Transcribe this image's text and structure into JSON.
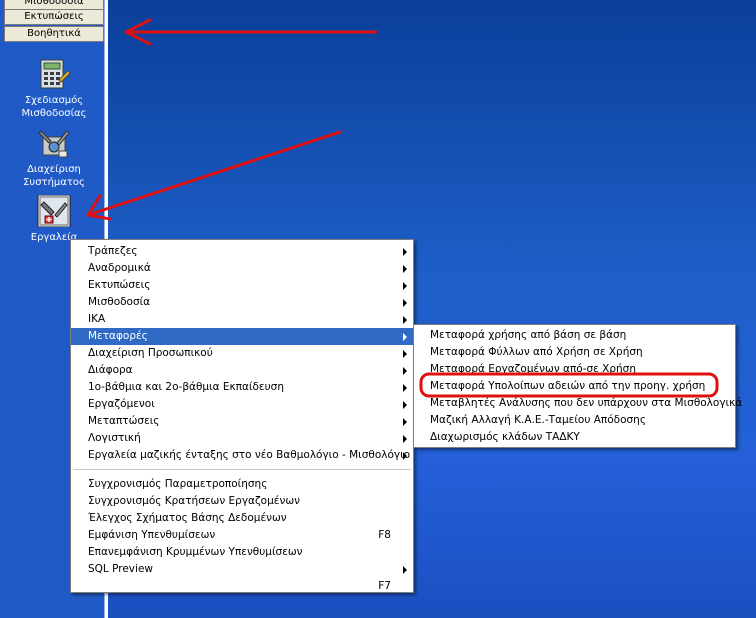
{
  "sidebar": {
    "buttons": [
      "Μισθοδοσία",
      "Εκτυπώσεις",
      "Βοηθητικά"
    ],
    "tools": [
      {
        "line1": "Σχεδιασμός",
        "line2": "Μισθοδοσίας",
        "icon": "calculator-icon"
      },
      {
        "line1": "Διαχείριση",
        "line2": "Συστήματος",
        "icon": "admin-tools-icon"
      },
      {
        "line1": "Εργαλεία",
        "line2": "",
        "icon": "tools-icon"
      }
    ]
  },
  "menu": {
    "items": [
      {
        "label": "Τράπεζες",
        "arrow": true
      },
      {
        "label": "Αναδρομικά",
        "arrow": true
      },
      {
        "label": "Εκτυπώσεις",
        "arrow": true
      },
      {
        "label": "Μισθοδοσία",
        "arrow": true
      },
      {
        "label": "ΙΚΑ",
        "arrow": true
      },
      {
        "label": "Μεταφορές",
        "arrow": true,
        "selected": true
      },
      {
        "label": "Διαχείριση Προσωπικού",
        "arrow": true
      },
      {
        "label": "Διάφορα",
        "arrow": true
      },
      {
        "label": "1ο-βάθμια και 2ο-βάθμια Εκπαίδευση",
        "arrow": true
      },
      {
        "label": "Εργαζόμενοι",
        "arrow": true
      },
      {
        "label": "Μεταπτώσεις",
        "arrow": true
      },
      {
        "label": "Λογιστική",
        "arrow": true
      },
      {
        "label": "Εργαλεία μαζικής ένταξης στο νέο Βαθμολόγιο - Μισθολόγιο",
        "arrow": true
      }
    ],
    "items2": [
      {
        "label": "Συγχρονισμός Παραμετροποίησης",
        "shortcut": ""
      },
      {
        "label": "Συγχρονισμός Κρατήσεων Εργαζομένων",
        "shortcut": ""
      },
      {
        "label": "Έλεγχος Σχήματος Βάσης Δεδομένων",
        "shortcut": ""
      },
      {
        "label": "Εμφάνιση Υπενθυμίσεων",
        "shortcut": "F8"
      },
      {
        "label": "Επανεμφάνιση Κρυμμένων Υπενθυμίσεων",
        "shortcut": ""
      },
      {
        "label": "SQL Preview",
        "shortcut": "",
        "arrow": true
      },
      {
        "label": "",
        "shortcut": "F7"
      }
    ]
  },
  "submenu": {
    "items": [
      "Μεταφορά χρήσης από βάση σε βάση",
      "Μεταφορά Φύλλων από Χρήση σε Χρήση",
      "Μεταφορά Εργαζομένων από-σε Χρήση",
      "Μεταφορά Υπολοίπων αδειών από την προηγ. χρήση",
      "Μεταβλητές Ανάλυσης που δεν υπάρχουν στα Μισθολογικά",
      "Μαζική Αλλαγή Κ.Α.Ε.-Ταμείου Απόδοσης",
      "Διαχωρισμός κλάδων ΤΑΔΚΥ"
    ],
    "highlighted_index": 3
  },
  "colors": {
    "selection": "#316ac5",
    "annotation": "#e01010"
  }
}
